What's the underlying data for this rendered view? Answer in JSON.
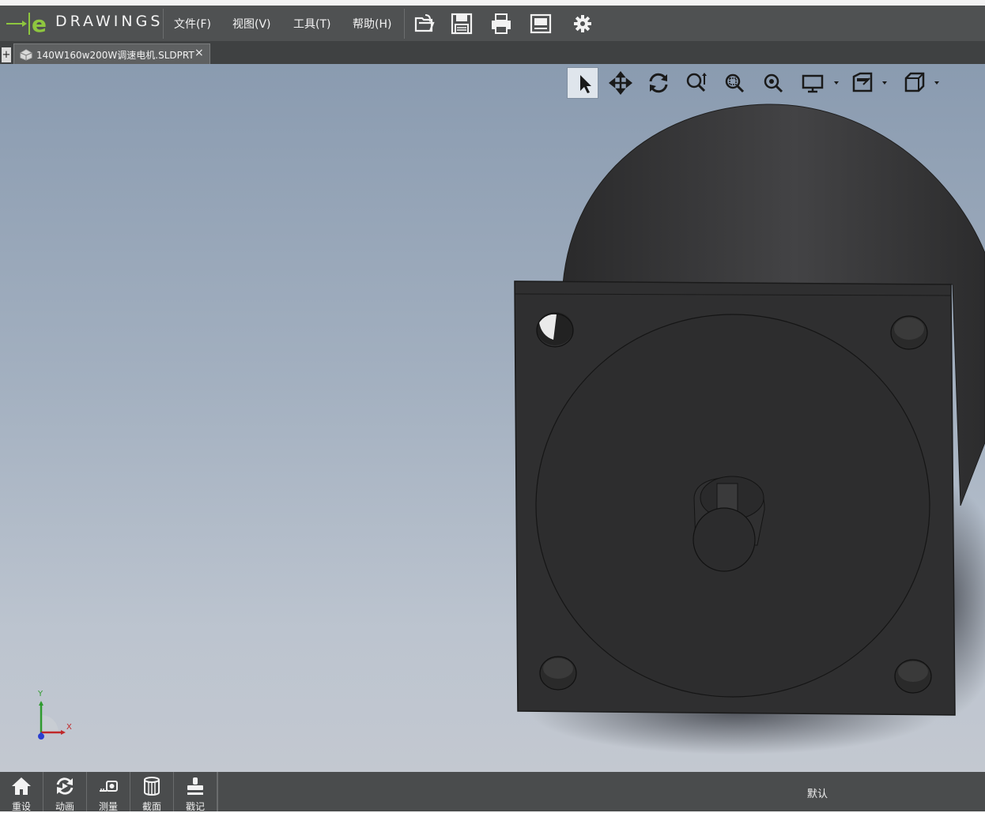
{
  "app": {
    "brand": "DRAWINGS"
  },
  "menu": {
    "items": [
      {
        "label": "文件(F)"
      },
      {
        "label": "视图(V)"
      },
      {
        "label": "工具(T)"
      },
      {
        "label": "帮助(H)"
      }
    ]
  },
  "toolbar": {
    "icons": [
      "open-icon",
      "save-icon",
      "print-icon",
      "page-setup-icon",
      "settings-icon"
    ]
  },
  "tabs": {
    "new_tab": "+",
    "document": {
      "label": "140W160w200W调速电机.SLDPRT",
      "close": "×"
    }
  },
  "viewport_toolbar": {
    "icons": [
      "select-icon",
      "pan-icon",
      "rotate-icon",
      "zoom-to-fit-icon",
      "zoom-to-area-icon",
      "zoom-in-out-icon",
      "display-style-icon",
      "view-settings-icon",
      "view-orientation-icon"
    ]
  },
  "triad": {
    "y_label": "Y",
    "x_label": "X"
  },
  "bottombar": {
    "buttons": [
      {
        "label": "重设",
        "icon": "home-icon"
      },
      {
        "label": "动画",
        "icon": "animate-icon"
      },
      {
        "label": "测量",
        "icon": "measure-icon"
      },
      {
        "label": "截面",
        "icon": "section-icon"
      },
      {
        "label": "戳记",
        "icon": "stamp-icon"
      }
    ],
    "configuration": "默认"
  },
  "colors": {
    "menubar": "#4f5152",
    "logo_green": "#8ec63f",
    "model": "#2e2e2e",
    "background_top": "#8a9bb0",
    "background_bottom": "#c3c8d0"
  }
}
